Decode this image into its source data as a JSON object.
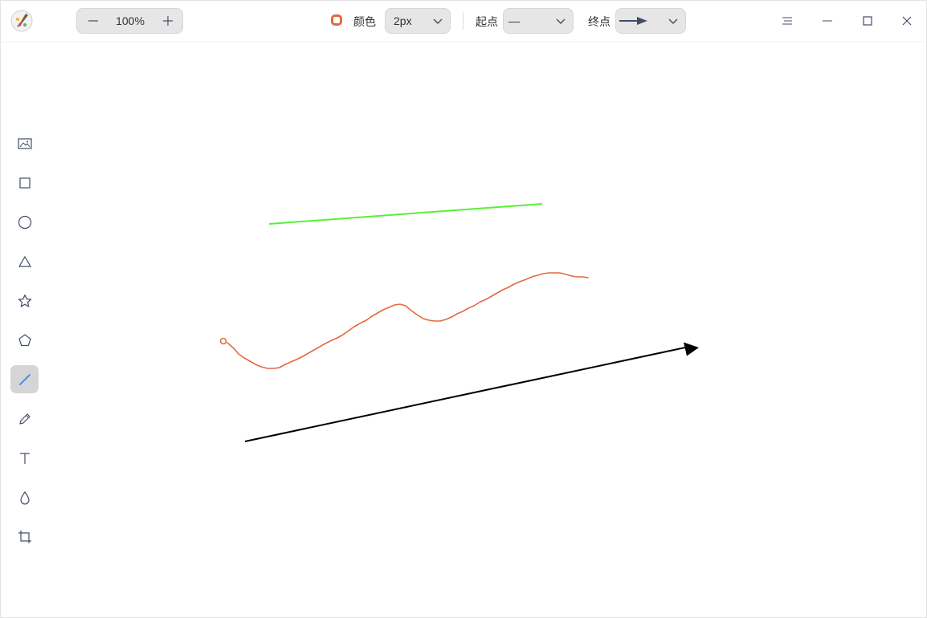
{
  "zoom": {
    "value": "100%"
  },
  "toolbar": {
    "color_label": "颜色",
    "color": "#e36a3f",
    "width_value": "2px",
    "start_label": "起点",
    "start_value": "—",
    "end_label": "终点",
    "end_value": "arrow"
  },
  "tools": [
    {
      "name": "image",
      "icon": "image-icon"
    },
    {
      "name": "rectangle",
      "icon": "rectangle-icon"
    },
    {
      "name": "ellipse",
      "icon": "circle-icon"
    },
    {
      "name": "triangle",
      "icon": "triangle-icon"
    },
    {
      "name": "star",
      "icon": "star-icon"
    },
    {
      "name": "polygon",
      "icon": "pentagon-icon"
    },
    {
      "name": "line",
      "icon": "line-icon",
      "active": true
    },
    {
      "name": "pencil",
      "icon": "pencil-icon"
    },
    {
      "name": "text",
      "icon": "text-icon"
    },
    {
      "name": "blur",
      "icon": "drop-icon"
    },
    {
      "name": "crop",
      "icon": "crop-icon"
    }
  ],
  "colors": {
    "green_line": "#59f036",
    "orange_stroke": "#e36a3f",
    "black_arrow": "#000000",
    "accent": "#2f8cf3"
  }
}
